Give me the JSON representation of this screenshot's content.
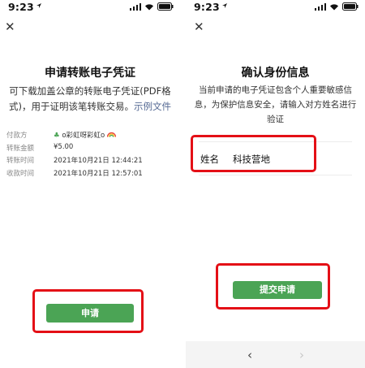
{
  "statusbar": {
    "time": "9:23"
  },
  "colors": {
    "accent_green": "#4ba455",
    "highlight_red": "#e40f16",
    "link_blue": "#576b95"
  },
  "left": {
    "title": "申请转账电子凭证",
    "desc_line1": "可下载加盖公章的转账电子凭证(PDF格",
    "desc_line2_prefix": "式)，用于证明该笔转账交易。",
    "desc_link": "示例文件",
    "rows": [
      {
        "label": "付款方",
        "value": "o彩虹呀彩虹o"
      },
      {
        "label": "转账金额",
        "value": "¥5.00"
      },
      {
        "label": "转账时间",
        "value": "2021年10月21日 12:44:21"
      },
      {
        "label": "收款时间",
        "value": "2021年10月21日 12:57:01"
      }
    ],
    "apply_label": "申请"
  },
  "right": {
    "title": "确认身份信息",
    "desc_line1": "当前申请的电子凭证包含个人重要敏感信",
    "desc_line2": "息，为保护信息安全，请输入对方姓名进行",
    "desc_line3": "验证",
    "name_label": "姓名",
    "name_value": "科技营地",
    "submit_label": "提交申请",
    "back_icon": "chevron-left-icon",
    "forward_icon": "chevron-right-icon"
  }
}
